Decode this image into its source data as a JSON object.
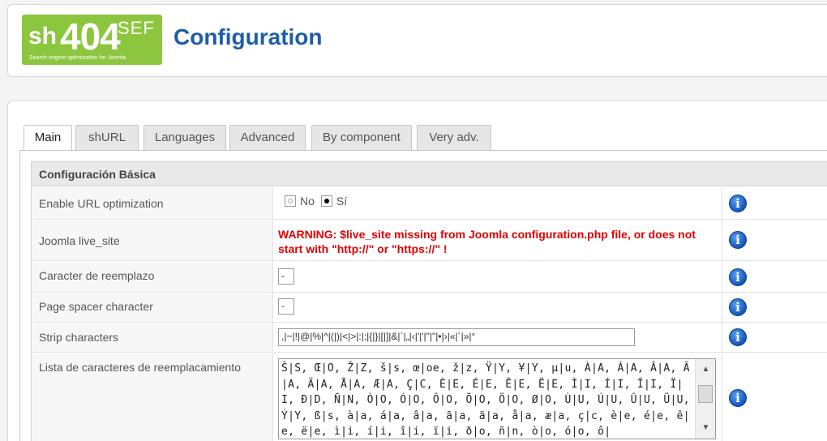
{
  "header": {
    "logo": {
      "sh": "sh",
      "num": "404",
      "sef": "SEF",
      "tagline": "Search engine optimization for Joomla"
    },
    "title": "Configuration"
  },
  "tabs": [
    {
      "label": "Main",
      "active": true
    },
    {
      "label": "shURL",
      "active": false
    },
    {
      "label": "Languages",
      "active": false
    },
    {
      "label": "Advanced",
      "active": false
    },
    {
      "label": "By component",
      "active": false
    },
    {
      "label": "Very adv.",
      "active": false
    }
  ],
  "section": {
    "legend": "Configuración Básica"
  },
  "rows": {
    "url_opt": {
      "label": "Enable URL optimization",
      "option_no": "No",
      "option_yes": "Sí",
      "selected": "Sí"
    },
    "live_site": {
      "label": "Joomla live_site",
      "warning": "WARNING: $live_site missing from Joomla configuration.php file, or does not start with \"http://\" or \"https://\" !"
    },
    "replacement": {
      "label": "Caracter de reemplazo",
      "value": "-"
    },
    "spacer": {
      "label": "Page spacer character",
      "value": "-"
    },
    "strip": {
      "label": "Strip characters",
      "value": ",|~|!|@|%|^|(|)|<|>|:|;|{|}|[|]|&|`|„|‹|'|'|\"|\"|•|›|«|´|»|°"
    },
    "replace_list": {
      "label": "Lista de caracteres de reemplacamiento",
      "value": "Š|S, Œ|O, Ž|Z, š|s, œ|oe, ž|z, Ÿ|Y, ¥|Y, µ|u, À|A, Á|A, Â|A, Ã|A, Ä|A, Å|A, Æ|A, Ç|C, È|E, É|E, Ê|E, Ë|E, Ì|I, Í|I, Î|I, Ï|I, Ð|D, Ñ|N, Ò|O, Ó|O, Ô|O, Õ|O, Ö|O, Ø|O, Ù|U, Ú|U, Û|U, Ü|U, Ý|Y, ß|s, à|a, á|a, â|a, ã|a, ä|a, å|a, æ|a, ç|c, è|e, é|e, ê|e, ë|e, ì|i, í|i, î|i, ï|i, ð|o, ñ|n, ò|o, ó|o, ô|"
    }
  },
  "info_icon_glyph": "i",
  "colors": {
    "title": "#1f5ea8",
    "logo": "#8cc63f",
    "warning": "#e00000",
    "info": "#1a5fc4"
  }
}
